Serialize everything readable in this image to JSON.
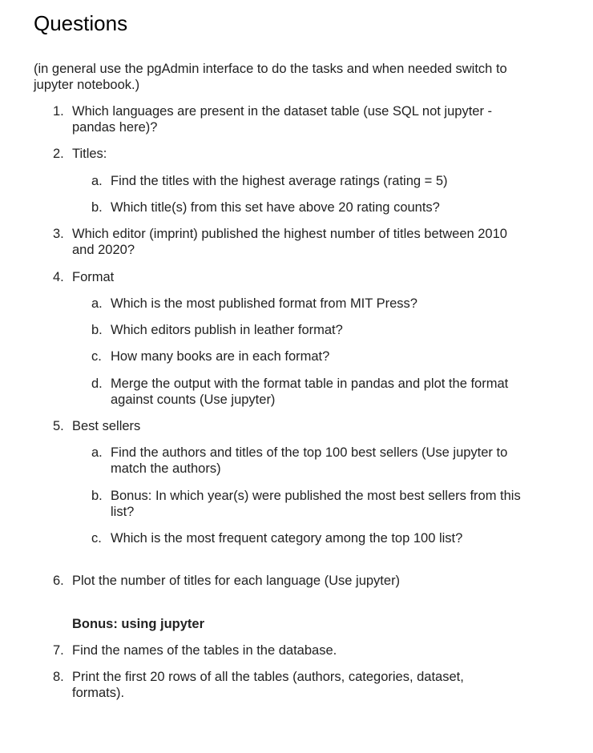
{
  "title": "Questions",
  "intro": "(in general use the pgAdmin interface to do the tasks and when needed switch to jupyter notebook.)",
  "items": [
    {
      "num": "1.",
      "text": "Which languages are present in the dataset table (use SQL not jupyter - pandas here)?"
    },
    {
      "num": "2.",
      "text": "Titles:"
    },
    {
      "num": "a.",
      "text": "Find the titles with the highest average ratings (rating = 5)"
    },
    {
      "num": "b.",
      "text": "Which title(s) from this set have above 20 rating counts?"
    },
    {
      "num": "3.",
      "text": "Which editor (imprint) published the highest number of titles between 2010 and 2020?"
    },
    {
      "num": "4.",
      "text": "Format"
    },
    {
      "num": "a.",
      "text": "Which is the most published format from MIT Press?"
    },
    {
      "num": "b.",
      "text": "Which editors publish in leather format?"
    },
    {
      "num": "c.",
      "text": "How many books are in each format?"
    },
    {
      "num": "d.",
      "text": "Merge the output with the format table in pandas and plot the format against counts (Use jupyter)"
    },
    {
      "num": "5.",
      "text": "Best sellers"
    },
    {
      "num": "a.",
      "text": "Find the authors and titles of the top 100 best sellers (Use jupyter to match the authors)"
    },
    {
      "num": "b.",
      "text": "Bonus: In which year(s) were published the most best sellers from this list?"
    },
    {
      "num": "c.",
      "text": "Which is the most frequent category among the top 100 list?"
    },
    {
      "num": "6.",
      "text": "Plot the number of titles for each language (Use jupyter)"
    },
    {
      "num": "",
      "text": "Bonus: using jupyter"
    },
    {
      "num": "7.",
      "text": "Find the names of the tables in the database."
    },
    {
      "num": "8.",
      "text": "Print the first 20 rows of all the tables (authors, categories, dataset, formats)."
    }
  ]
}
